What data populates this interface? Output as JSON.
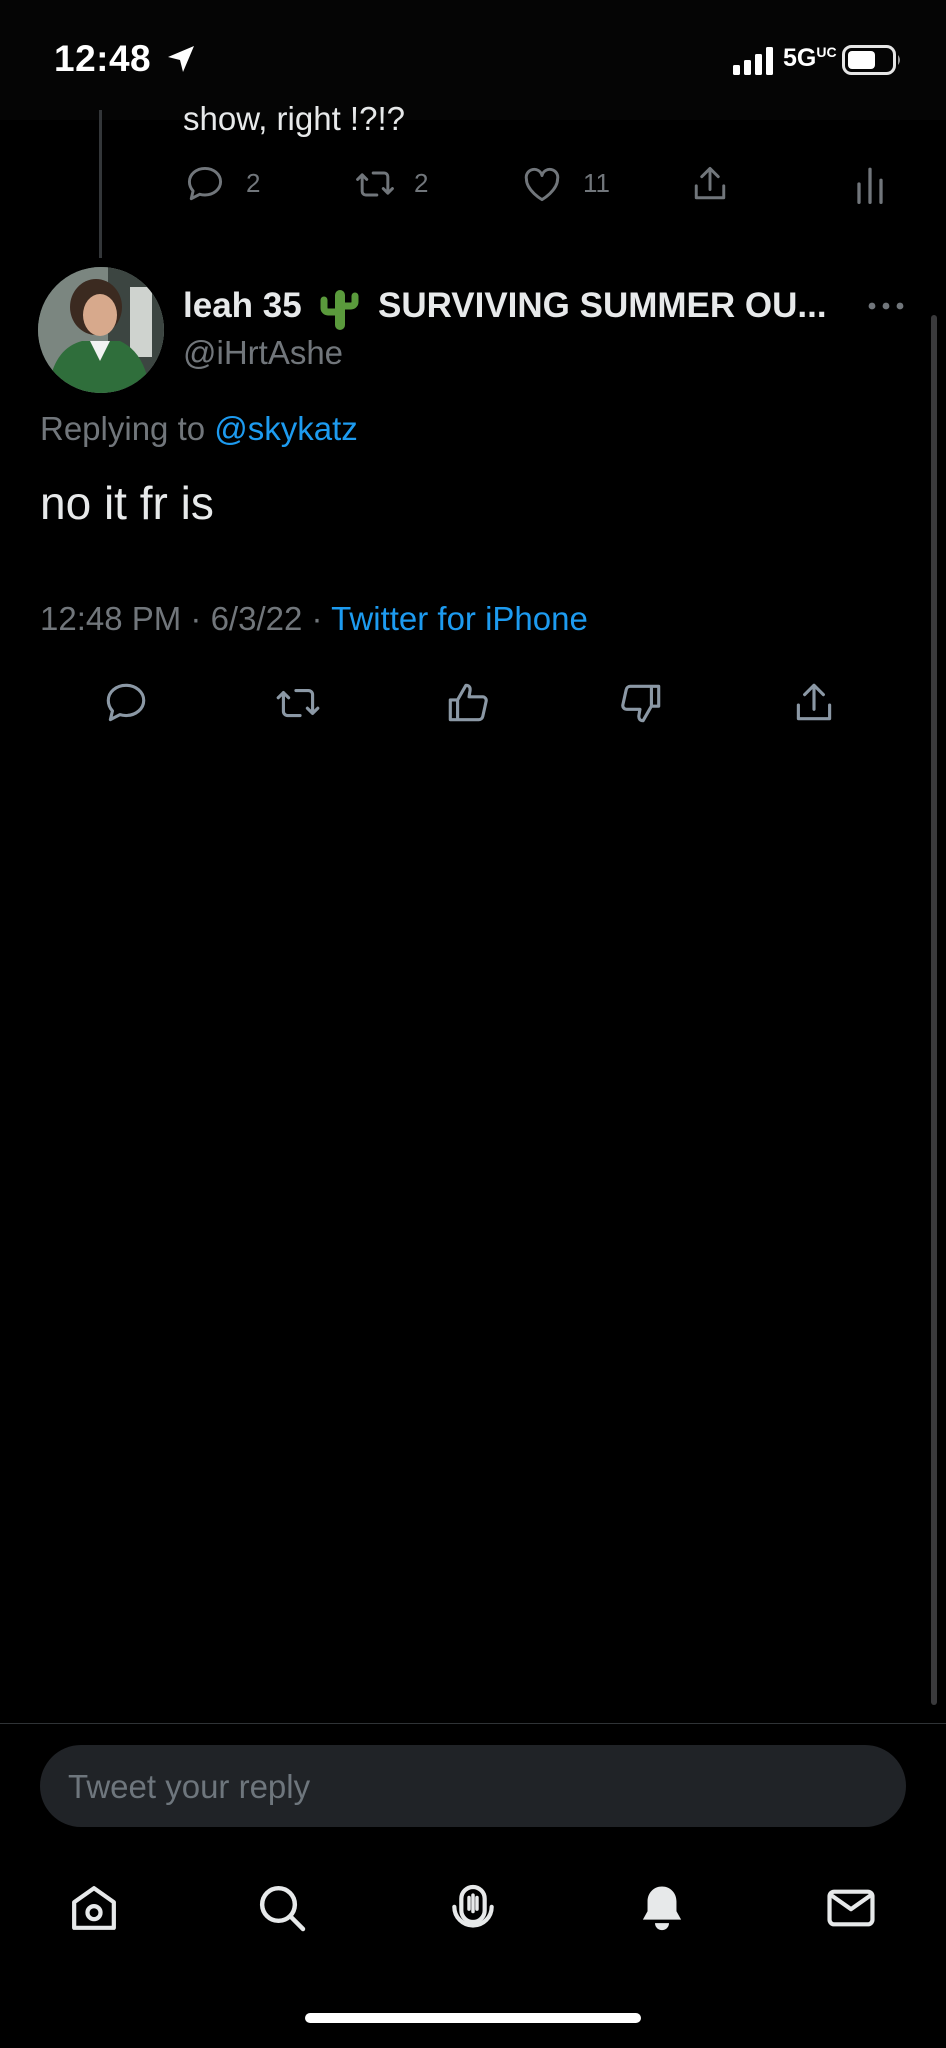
{
  "status_bar": {
    "time": "12:48",
    "network": "5G",
    "network_superscript": "UC"
  },
  "previous_tweet": {
    "text_tail": "show, right !?!?",
    "reply_count": "2",
    "retweet_count": "2",
    "like_count": "11"
  },
  "tweet": {
    "display_name": "leah 35",
    "emoji": "cactus",
    "display_name_suffix": "SURVIVING SUMMER OU...",
    "handle": "@iHrtAshe",
    "replying_prefix": "Replying to",
    "replying_handle": "@skykatz",
    "text": "no it fr is",
    "timestamp": "12:48 PM · 6/3/22 ·",
    "source": "Twitter for iPhone"
  },
  "reply_box": {
    "placeholder": "Tweet your reply"
  },
  "icons": {
    "actions": [
      "reply-icon",
      "retweet-icon",
      "thumbs-up-icon",
      "thumbs-down-icon",
      "share-icon"
    ],
    "nav": [
      "home-icon",
      "search-icon",
      "spaces-icon",
      "notifications-icon",
      "messages-icon"
    ]
  },
  "colors": {
    "background": "#000000",
    "text": "#e7e9ea",
    "muted": "#71767b",
    "link": "#1d9bf0"
  }
}
